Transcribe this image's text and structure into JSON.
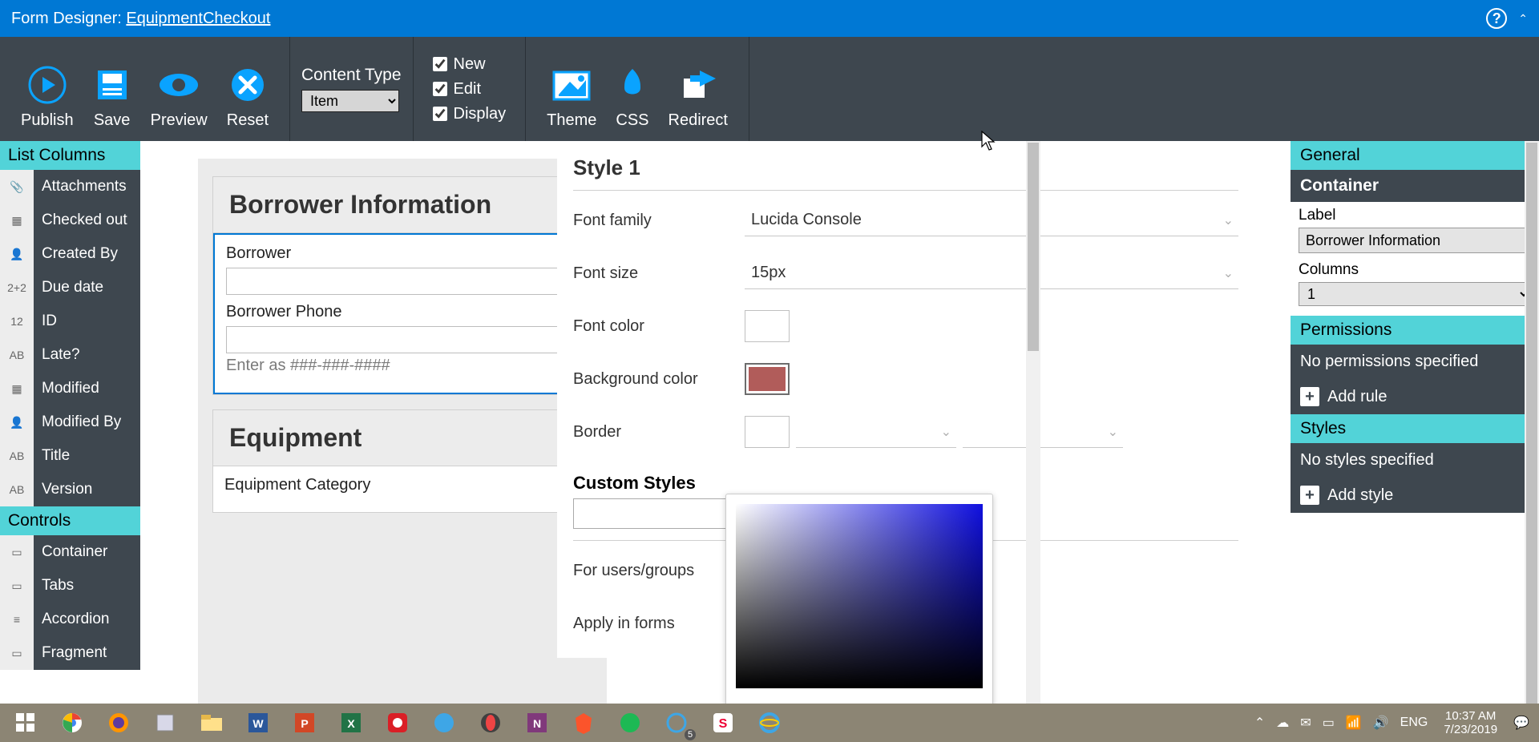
{
  "titlebar": {
    "prefix": "Form Designer: ",
    "formName": "EquipmentCheckout"
  },
  "ribbon": {
    "publish": "Publish",
    "save": "Save",
    "preview": "Preview",
    "reset": "Reset",
    "contentTypeLabel": "Content Type",
    "contentTypeValue": "Item",
    "chkNew": "New",
    "chkEdit": "Edit",
    "chkDisplay": "Display",
    "theme": "Theme",
    "css": "CSS",
    "redirect": "Redirect"
  },
  "leftPanel": {
    "listColumns": "List Columns",
    "columns": [
      {
        "icon": "📎",
        "label": "Attachments"
      },
      {
        "icon": "▦",
        "label": "Checked out"
      },
      {
        "icon": "👤",
        "label": "Created By"
      },
      {
        "icon": "2+2",
        "label": "Due date"
      },
      {
        "icon": "12",
        "label": "ID"
      },
      {
        "icon": "AB",
        "label": "Late?"
      },
      {
        "icon": "▦",
        "label": "Modified"
      },
      {
        "icon": "👤",
        "label": "Modified By"
      },
      {
        "icon": "AB",
        "label": "Title"
      },
      {
        "icon": "AB",
        "label": "Version"
      }
    ],
    "controls": "Controls",
    "controlItems": [
      {
        "icon": "▭",
        "label": "Container"
      },
      {
        "icon": "▭",
        "label": "Tabs"
      },
      {
        "icon": "≡",
        "label": "Accordion"
      },
      {
        "icon": "▭",
        "label": "Fragment"
      }
    ]
  },
  "canvas": {
    "section1": {
      "title": "Borrower Information",
      "field1Label": "Borrower",
      "field2Label": "Borrower Phone",
      "helperText": "Enter as ###-###-####"
    },
    "section2": {
      "title": "Equipment",
      "field1Label": "Equipment Category"
    }
  },
  "stylePanel": {
    "title": "Style 1",
    "fontFamilyLabel": "Font family",
    "fontFamilyValue": "Lucida Console",
    "fontSizeLabel": "Font size",
    "fontSizeValue": "15px",
    "fontColorLabel": "Font color",
    "bgColorLabel": "Background color",
    "bgColorValue": "#b15c5a",
    "borderLabel": "Border",
    "customStylesLabel": "Custom Styles",
    "forUsersLabel": "For users/groups",
    "applyInFormsLabel": "Apply in forms"
  },
  "rightPanel": {
    "general": "General",
    "container": "Container",
    "labelLabel": "Label",
    "labelValue": "Borrower Information",
    "columnsLabel": "Columns",
    "columnsValue": "1",
    "permissions": "Permissions",
    "noPermissions": "No permissions specified",
    "addRule": "Add rule",
    "styles": "Styles",
    "noStyles": "No styles specified",
    "addStyle": "Add style"
  },
  "taskbar": {
    "lang": "ENG",
    "time": "10:37 AM",
    "date": "7/23/2019",
    "badge": "5"
  }
}
